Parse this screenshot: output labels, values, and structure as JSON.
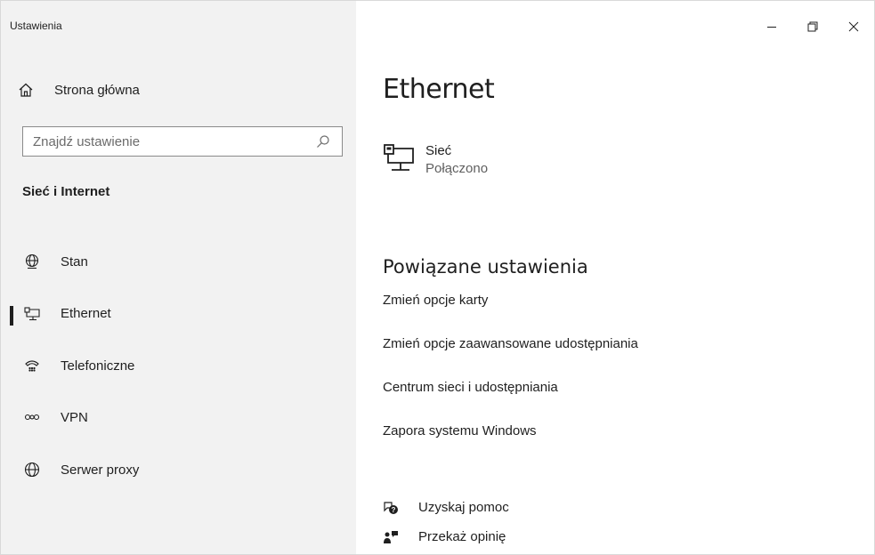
{
  "window": {
    "title": "Ustawienia",
    "controls": {
      "minimize": "–",
      "maximize": "❐",
      "close": "✕"
    }
  },
  "sidebar": {
    "home_label": "Strona główna",
    "search_placeholder": "Znajdź ustawienie",
    "section_title": "Sieć i Internet",
    "items": [
      {
        "label": "Stan",
        "icon": "globe-status-icon",
        "active": false
      },
      {
        "label": "Ethernet",
        "icon": "ethernet-icon",
        "active": true
      },
      {
        "label": "Telefoniczne",
        "icon": "dialup-icon",
        "active": false
      },
      {
        "label": "VPN",
        "icon": "vpn-icon",
        "active": false
      },
      {
        "label": "Serwer proxy",
        "icon": "globe-icon",
        "active": false
      }
    ]
  },
  "main": {
    "title": "Ethernet",
    "network": {
      "name": "Sieć",
      "status": "Połączono"
    },
    "related": {
      "title": "Powiązane ustawienia",
      "links": [
        "Zmień opcje karty",
        "Zmień opcje zaawansowane udostępniania",
        "Centrum sieci i udostępniania",
        "Zapora systemu Windows"
      ]
    },
    "help": {
      "get_help": "Uzyskaj pomoc",
      "feedback": "Przekaż opinię"
    }
  },
  "colors": {
    "sidebar_bg": "#f2f2f2",
    "text": "#1f1f1f",
    "accent_bar": "#1f1f1f"
  }
}
